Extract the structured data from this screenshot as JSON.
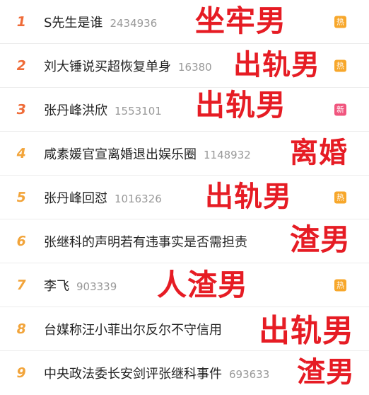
{
  "hot_list": [
    {
      "rank": "1",
      "title": "S先生是谁",
      "count": "2434936",
      "badge": "热",
      "badge_color": "#f7a72b",
      "overlay": "坐牢男"
    },
    {
      "rank": "2",
      "title": "刘大锤说买超恢复单身",
      "count": "16380",
      "badge": "热",
      "badge_color": "#f7a72b",
      "overlay": "出轨男"
    },
    {
      "rank": "3",
      "title": "张丹峰洪欣",
      "count": "1553101",
      "badge": "新",
      "badge_color": "#f0557e",
      "overlay": "出轨男"
    },
    {
      "rank": "4",
      "title": "咸素媛官宣离婚退出娱乐圈",
      "count": "1148932",
      "badge": "",
      "badge_color": "",
      "overlay": "离婚"
    },
    {
      "rank": "5",
      "title": "张丹峰回怼",
      "count": "1016326",
      "badge": "热",
      "badge_color": "#f7a72b",
      "overlay": "出轨男"
    },
    {
      "rank": "6",
      "title": "张继科的声明若有违事实是否需担责",
      "count": "",
      "badge": "",
      "badge_color": "",
      "overlay": "渣男"
    },
    {
      "rank": "7",
      "title": "李飞",
      "count": "903339",
      "badge": "热",
      "badge_color": "#f7a72b",
      "overlay": "人渣男"
    },
    {
      "rank": "8",
      "title": "台媒称汪小菲出尔反尔不守信用",
      "count": "",
      "badge": "",
      "badge_color": "",
      "overlay": "出轨男"
    },
    {
      "rank": "9",
      "title": "中央政法委长安剑评张继科事件",
      "count": "693633",
      "badge": "",
      "badge_color": "",
      "overlay": "渣男"
    }
  ],
  "colors": {
    "overlay_text": "#e61c24",
    "rank_top": "#ef6b38",
    "rank_rest": "#f2a43a"
  }
}
